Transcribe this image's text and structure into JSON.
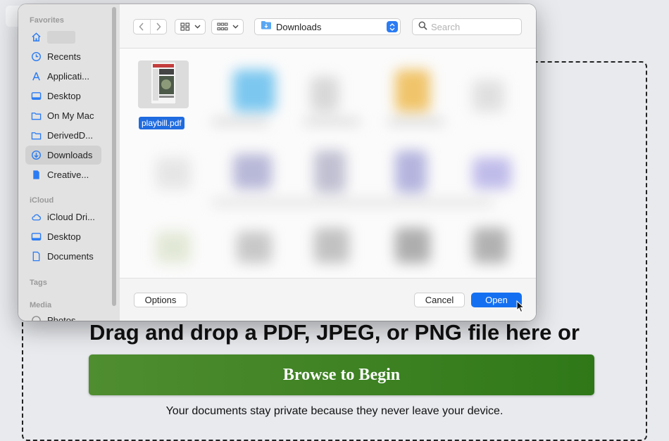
{
  "dialog": {
    "sidebar": {
      "sections": {
        "favorites": "Favorites",
        "icloud": "iCloud",
        "tags": "Tags",
        "media": "Media"
      },
      "favorites": [
        {
          "label": "",
          "icon": "home-icon"
        },
        {
          "label": "Recents",
          "icon": "clock-icon"
        },
        {
          "label": "Applicati...",
          "icon": "applications-icon"
        },
        {
          "label": "Desktop",
          "icon": "desktop-icon"
        },
        {
          "label": "On My Mac",
          "icon": "folder-icon"
        },
        {
          "label": "DerivedD...",
          "icon": "folder-icon"
        },
        {
          "label": "Downloads",
          "icon": "downloads-icon",
          "selected": true
        },
        {
          "label": "Creative...",
          "icon": "document-icon"
        }
      ],
      "icloud": [
        {
          "label": "iCloud Dri...",
          "icon": "cloud-icon"
        },
        {
          "label": "Desktop",
          "icon": "desktop-icon"
        },
        {
          "label": "Documents",
          "icon": "document-icon"
        }
      ],
      "media": [
        {
          "label": "Photos",
          "icon": "photos-icon"
        }
      ]
    },
    "toolbar": {
      "location": "Downloads",
      "search_placeholder": "Search"
    },
    "selected_file": "playbill.pdf",
    "footer": {
      "options": "Options",
      "cancel": "Cancel",
      "open": "Open"
    },
    "colors": {
      "accent": "#1470f0",
      "selection": "#1f6be0"
    }
  },
  "page": {
    "headline": "Drag and drop a PDF, JPEG, or PNG file here or",
    "browse_button": "Browse to Begin",
    "privacy_note": "Your documents stay private because they never leave your device.",
    "colors": {
      "button": "#3f8424"
    }
  }
}
